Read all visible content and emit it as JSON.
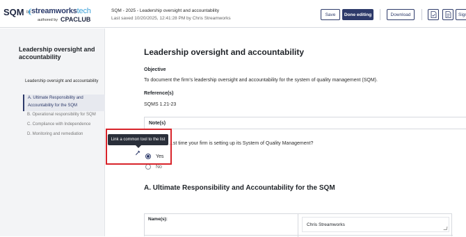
{
  "brand": {
    "product": "SQM",
    "by": "by",
    "company": "streamworks",
    "company_suffix": "tech",
    "authored_by": "authored by",
    "partner": "CPACLUB"
  },
  "header": {
    "doc_title": "SQM - 2025 - Leadership oversight and accountability",
    "last_saved": "Last saved 10/20/2025, 12:41:28 PM by Chris Streamworks",
    "save_label": "Save",
    "done_label": "Done editing",
    "download_label": "Download",
    "sign_label": "Sign",
    "icon_1": "document-check-icon",
    "icon_2": "document-icon"
  },
  "sidebar": {
    "title": "Leadership oversight and accountability",
    "section": "Leadership oversight and accountability",
    "items": [
      {
        "label": "A. Ultimate Responsibility and Accountability for the SQM",
        "active": true
      },
      {
        "label": "B. Operational responsibility for SQM",
        "active": false
      },
      {
        "label": "C. Compliance with Independence",
        "active": false
      },
      {
        "label": "D. Monitoring and remediation",
        "active": false
      }
    ]
  },
  "main": {
    "heading": "Leadership oversight and accountability",
    "objective_label": "Objective",
    "objective_text": "To document the firm's leadership oversight and accountability for the system of quality management (SQM).",
    "references_label": "Reference(s)",
    "references_text": "SQMS 1.21-23",
    "notes_label": "Note(s)",
    "question": "...st time your firm is setting up its System of Quality Management?",
    "options": [
      {
        "label": "Yes",
        "selected": true
      },
      {
        "label": "No",
        "selected": false
      }
    ],
    "section_heading": "A. Ultimate Responsibility and Accountability for the SQM",
    "names_label": "Name(s):",
    "names_value": "Chris Streamworks"
  },
  "tooltip": {
    "text": "Link a common tool to the list",
    "icon": "link-tool-icon"
  },
  "colors": {
    "accent": "#2d3a6a",
    "highlight": "#d8232a",
    "sidebar_bg": "#f3f4f6"
  }
}
